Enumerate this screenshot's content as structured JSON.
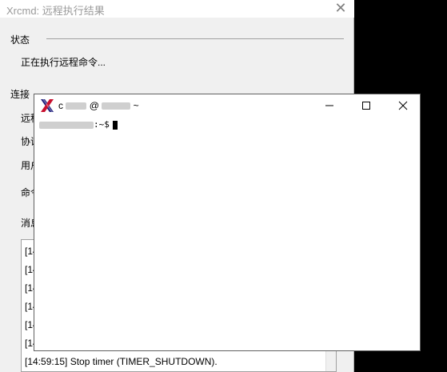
{
  "dialog": {
    "title": "Xrcmd: 远程执行结果",
    "status_group": "状态",
    "status_text": "正在执行远程命令...",
    "connection_group": "连接",
    "rows": [
      "远程",
      "协议",
      "用户",
      "命令",
      "消息"
    ],
    "messages": [
      "[14",
      "[14",
      "[14",
      "[14",
      "[14",
      "[14",
      "[14:59:15] Stop timer (TIMER_SHUTDOWN)."
    ]
  },
  "xterm": {
    "title_visible_start": "c",
    "title_at": "@",
    "title_tail": "~",
    "prompt_tail": ":~$"
  }
}
